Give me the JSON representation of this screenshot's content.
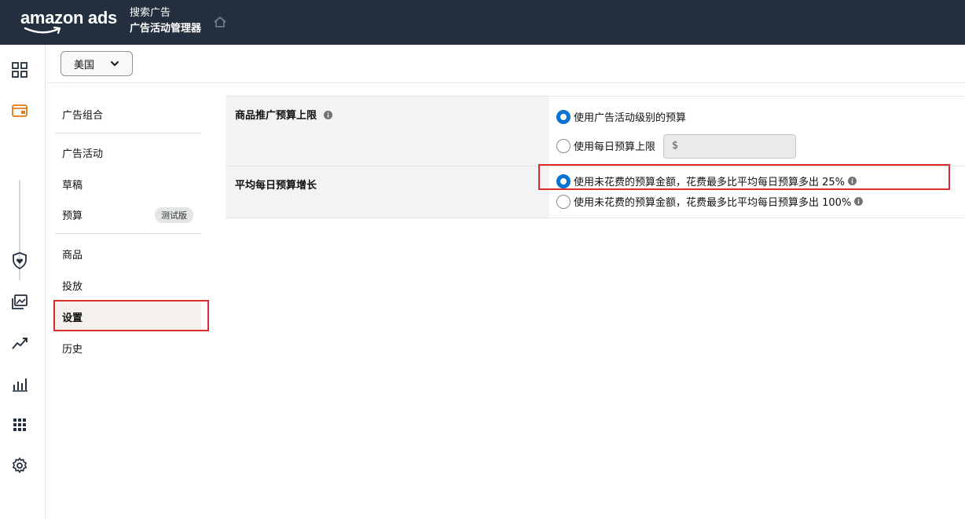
{
  "header": {
    "logo_text": "amazon ads",
    "product": "搜索广告",
    "section": "广告活动管理器"
  },
  "toolbar": {
    "country": "美国"
  },
  "subnav": {
    "items": [
      {
        "label": "广告组合"
      },
      {
        "label": "广告活动"
      },
      {
        "label": "草稿"
      },
      {
        "label": "预算",
        "badge": "测试版"
      },
      {
        "label": "商品"
      },
      {
        "label": "投放"
      },
      {
        "label": "设置",
        "active": true
      },
      {
        "label": "历史"
      }
    ]
  },
  "settings": {
    "budget_cap": {
      "label": "商品推广预算上限",
      "option_campaign": "使用广告活动级别的预算",
      "option_daily": "使用每日预算上限",
      "daily_input_placeholder": "$",
      "selected": "option_campaign"
    },
    "budget_increase": {
      "label": "平均每日预算增长",
      "option_25": "使用未花费的预算金额，花费最多比平均每日预算多出 25%",
      "option_100": "使用未花费的预算金额，花费最多比平均每日预算多出 100%",
      "selected": "option_25"
    }
  },
  "colors": {
    "topbar": "#232f3e",
    "accent_radio": "#0972d3",
    "highlight_border": "#d92c2c",
    "active_nav_bg": "#f4f1ec"
  }
}
